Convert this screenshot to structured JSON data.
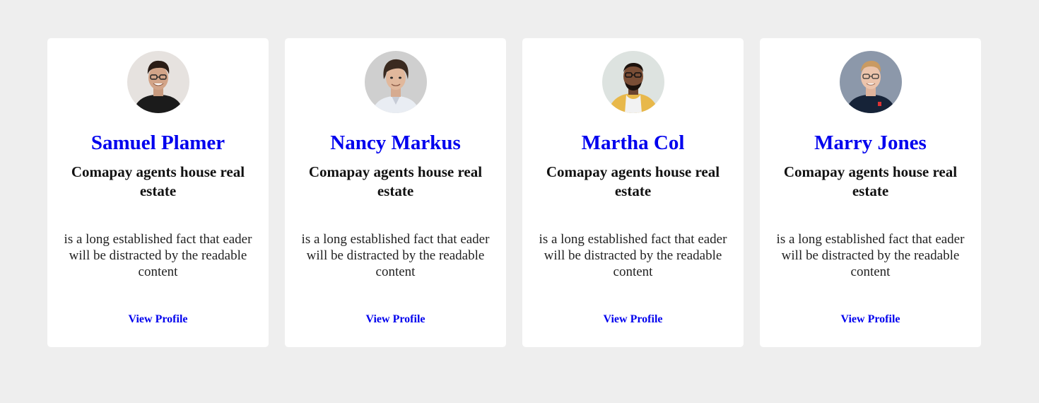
{
  "cards": [
    {
      "name": "Samuel Plamer",
      "company": "Comapay agents house real estate",
      "description": "is a long established fact that eader will be distracted by the readable content",
      "link_label": "View Profile",
      "avatar_icon": "person-avatar-icon"
    },
    {
      "name": "Nancy Markus",
      "company": "Comapay agents house real estate",
      "description": "is a long established fact that eader will be distracted by the readable content",
      "link_label": "View Profile",
      "avatar_icon": "person-avatar-icon"
    },
    {
      "name": "Martha Col",
      "company": "Comapay agents house real estate",
      "description": "is a long established fact that eader will be distracted by the readable content",
      "link_label": "View Profile",
      "avatar_icon": "person-avatar-icon"
    },
    {
      "name": "Marry Jones",
      "company": "Comapay agents house real estate",
      "description": "is a long established fact that eader will be distracted by the readable content",
      "link_label": "View Profile",
      "avatar_icon": "person-avatar-icon"
    }
  ],
  "colors": {
    "page_background": "#eeeeee",
    "card_background": "#ffffff",
    "name_color": "#0000ee",
    "link_color": "#0000ee",
    "text_color": "#111111"
  }
}
